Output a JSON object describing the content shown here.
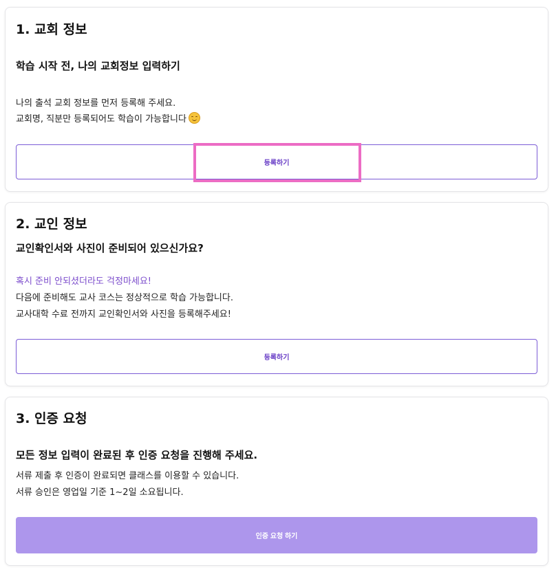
{
  "section1": {
    "title": "1. 교회 정보",
    "subtitle": "학습 시작 전, 나의 교회정보 입력하기",
    "line1": "나의 출석 교회 정보를 먼저 등록해 주세요.",
    "line2": "교회명, 직분만 등록되어도 학습이 가능합니다",
    "emoji": "smiling-face-icon",
    "button_label": "등록하기"
  },
  "section2": {
    "title": "2. 교인 정보",
    "subtitle": "교인확인서와 사진이 준비되어 있으신가요?",
    "highlight_line": "혹시 준비 안되셨더라도 걱정마세요!",
    "line1": "다음에 준비해도 교사 코스는 정상적으로 학습 가능합니다.",
    "line2": "교사대학 수료 전까지 교인확인서와 사진을 등록해주세요!",
    "button_label": "등록하기"
  },
  "section3": {
    "title": "3. 인증 요청",
    "subtitle": "모든 정보 입력이 완료된 후 인증 요청을 진행해 주세요.",
    "line1": "서류 제출 후 인증이 완료되면 클래스를 이용할 수 있습니다.",
    "line2": "서류 승인은 영업일 기준 1~2일 소요됩니다.",
    "button_label": "인증 요청 하기"
  },
  "colors": {
    "accent": "#7c4dcc",
    "button_border": "#7b5bd6",
    "button_fill": "#ad96ec",
    "highlight_box": "#ec6cc4"
  }
}
